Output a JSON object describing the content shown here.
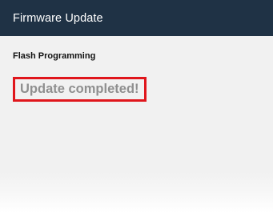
{
  "window": {
    "title": "Firmware Update"
  },
  "section": {
    "heading": "Flash Programming"
  },
  "status": {
    "message": "Update completed!",
    "highlight_color": "#e0161c",
    "text_color": "#8f8f8f"
  },
  "colors": {
    "titlebar_bg": "#1f3245",
    "content_bg": "#f1f1f1"
  }
}
